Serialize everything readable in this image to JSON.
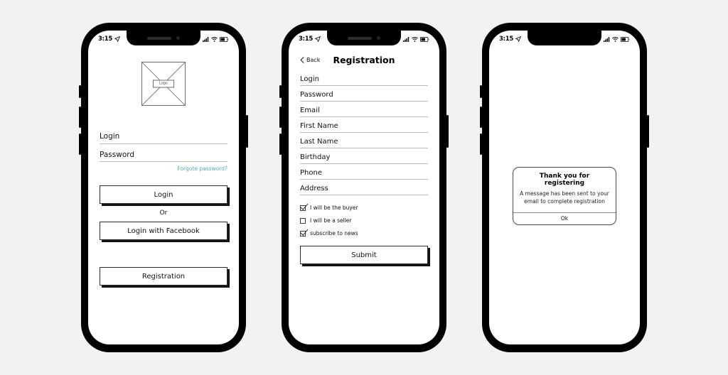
{
  "status_bar": {
    "time": "3:15",
    "location_icon": "location-arrow-icon",
    "signal_icon": "cellular-signal-icon",
    "wifi_icon": "wifi-icon",
    "battery_icon": "battery-icon"
  },
  "screens": [
    {
      "id": "login",
      "logo": {
        "label": "Logo",
        "icon": "image-placeholder-icon"
      },
      "fields": [
        {
          "label": "Login"
        },
        {
          "label": "Password"
        }
      ],
      "forgot_link": "Forgote password?",
      "forgot_link_color": "#5fa8a8",
      "primary_button": "Login",
      "divider_text": "Or",
      "facebook_button": "Login with Facebook",
      "registration_button": "Registration"
    },
    {
      "id": "registration",
      "nav": {
        "back_label": "Back",
        "back_icon": "chevron-left-icon",
        "title": "Registration"
      },
      "fields": [
        {
          "label": "Login"
        },
        {
          "label": "Password"
        },
        {
          "label": "Email"
        },
        {
          "label": "First Name"
        },
        {
          "label": "Last Name"
        },
        {
          "label": "Birthday"
        },
        {
          "label": "Phone"
        },
        {
          "label": "Address"
        }
      ],
      "checkboxes": [
        {
          "label": "I will be the buyer",
          "checked": true
        },
        {
          "label": "I will be a seller",
          "checked": false
        },
        {
          "label": "subscribe to news",
          "checked": true
        }
      ],
      "submit_button": "Submit"
    },
    {
      "id": "confirmation",
      "dialog": {
        "title": "Thank you for registering",
        "message": "A message has been sent to your email to complete registration",
        "ok_button": "Ok"
      }
    }
  ]
}
